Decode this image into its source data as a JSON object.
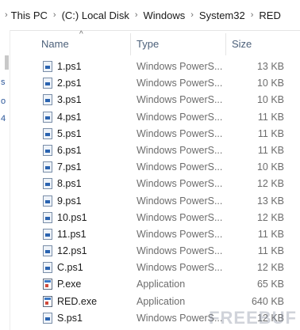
{
  "breadcrumb": [
    "This PC",
    "(C:) Local Disk",
    "Windows",
    "System32",
    "RED"
  ],
  "nav": {
    "frag1": "s",
    "frag2": "o",
    "frag3": "4"
  },
  "columns": {
    "name": "Name",
    "type": "Type",
    "size": "Size"
  },
  "files": [
    {
      "name": "1.ps1",
      "type": "Windows PowerS...",
      "size": "13 KB",
      "icon": "powershell-file-icon"
    },
    {
      "name": "2.ps1",
      "type": "Windows PowerS...",
      "size": "10 KB",
      "icon": "powershell-file-icon"
    },
    {
      "name": "3.ps1",
      "type": "Windows PowerS...",
      "size": "10 KB",
      "icon": "powershell-file-icon"
    },
    {
      "name": "4.ps1",
      "type": "Windows PowerS...",
      "size": "11 KB",
      "icon": "powershell-file-icon"
    },
    {
      "name": "5.ps1",
      "type": "Windows PowerS...",
      "size": "11 KB",
      "icon": "powershell-file-icon"
    },
    {
      "name": "6.ps1",
      "type": "Windows PowerS...",
      "size": "11 KB",
      "icon": "powershell-file-icon"
    },
    {
      "name": "7.ps1",
      "type": "Windows PowerS...",
      "size": "10 KB",
      "icon": "powershell-file-icon"
    },
    {
      "name": "8.ps1",
      "type": "Windows PowerS...",
      "size": "12 KB",
      "icon": "powershell-file-icon"
    },
    {
      "name": "9.ps1",
      "type": "Windows PowerS...",
      "size": "13 KB",
      "icon": "powershell-file-icon"
    },
    {
      "name": "10.ps1",
      "type": "Windows PowerS...",
      "size": "12 KB",
      "icon": "powershell-file-icon"
    },
    {
      "name": "11.ps1",
      "type": "Windows PowerS...",
      "size": "11 KB",
      "icon": "powershell-file-icon"
    },
    {
      "name": "12.ps1",
      "type": "Windows PowerS...",
      "size": "11 KB",
      "icon": "powershell-file-icon"
    },
    {
      "name": "C.ps1",
      "type": "Windows PowerS...",
      "size": "12 KB",
      "icon": "powershell-file-icon"
    },
    {
      "name": "P.exe",
      "type": "Application",
      "size": "65 KB",
      "icon": "application-icon"
    },
    {
      "name": "RED.exe",
      "type": "Application",
      "size": "640 KB",
      "icon": "application-icon"
    },
    {
      "name": "S.ps1",
      "type": "Windows PowerS...",
      "size": "12 KB",
      "icon": "powershell-file-icon"
    }
  ],
  "watermark": "FREEBUF"
}
